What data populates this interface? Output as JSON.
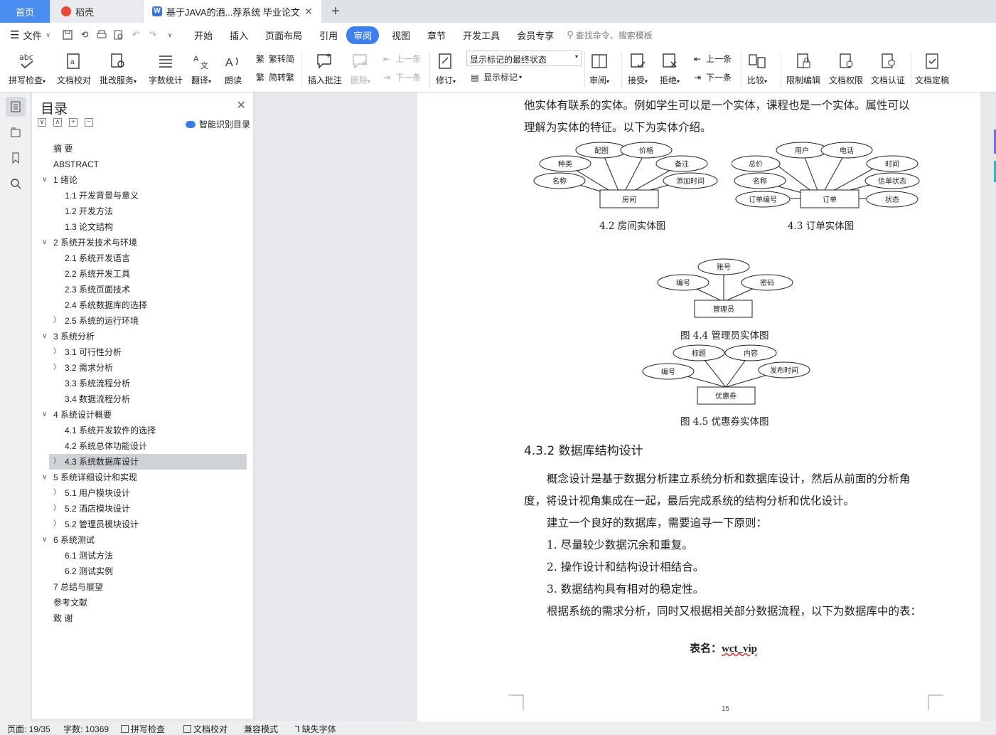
{
  "tabs": {
    "home": "首页",
    "daoke": "稻壳",
    "doc": "基于JAVA的酒...荐系统 毕业论文"
  },
  "menu": {
    "file": "文件",
    "items": [
      "开始",
      "插入",
      "页面布局",
      "引用",
      "审阅",
      "视图",
      "章节",
      "开发工具",
      "会员专享"
    ],
    "active": "审阅",
    "search_placeholder": "查找命令、搜索模板"
  },
  "ribbon": {
    "spell_check": "拼写检查",
    "doc_proof": "文档校对",
    "review_service": "批改服务",
    "word_count": "字数统计",
    "translate": "翻译",
    "read_aloud": "朗读",
    "to_traditional": "繁转简",
    "to_simplified": "简转繁",
    "insert_comment": "插入批注",
    "delete": "删除",
    "prev_item": "上一条",
    "next_item": "下一条",
    "revise": "修订",
    "markup_select": "显示标记的最终状态",
    "show_markup": "显示标记",
    "review": "审阅",
    "accept": "接受",
    "reject": "拒绝",
    "prev": "上一条",
    "next": "下一条",
    "compare": "比较",
    "restrict_edit": "限制编辑",
    "doc_permission": "文档权限",
    "doc_certify": "文档认证",
    "doc_finalize": "文档定稿"
  },
  "toc": {
    "title": "目录",
    "smart_label": "智能识别目录",
    "items": [
      {
        "label": "摘    要",
        "level": 0,
        "chevron": ""
      },
      {
        "label": "ABSTRACT",
        "level": 0,
        "chevron": ""
      },
      {
        "label": "1 绪论",
        "level": 0,
        "chevron": "down"
      },
      {
        "label": "1.1 开发背景与意义",
        "level": 1,
        "chevron": ""
      },
      {
        "label": "1.2 开发方法",
        "level": 1,
        "chevron": ""
      },
      {
        "label": "1.3 论文结构",
        "level": 1,
        "chevron": ""
      },
      {
        "label": "2 系统开发技术与环境",
        "level": 0,
        "chevron": "down"
      },
      {
        "label": "2.1  系统开发语言",
        "level": 1,
        "chevron": ""
      },
      {
        "label": "2.2  系统开发工具",
        "level": 1,
        "chevron": ""
      },
      {
        "label": "2.3  系统页面技术",
        "level": 1,
        "chevron": ""
      },
      {
        "label": "2.4  系统数据库的选择",
        "level": 1,
        "chevron": ""
      },
      {
        "label": "2.5  系统的运行环境",
        "level": 1,
        "chevron": "right"
      },
      {
        "label": "3  系统分析",
        "level": 0,
        "chevron": "down"
      },
      {
        "label": "3.1 可行性分析",
        "level": 1,
        "chevron": "right"
      },
      {
        "label": "3.2 需求分析",
        "level": 1,
        "chevron": "right"
      },
      {
        "label": "3.3 系统流程分析",
        "level": 1,
        "chevron": ""
      },
      {
        "label": "3.4 数据流程分析",
        "level": 1,
        "chevron": ""
      },
      {
        "label": "4  系统设计概要",
        "level": 0,
        "chevron": "down"
      },
      {
        "label": "4.1  系统开发软件的选择",
        "level": 1,
        "chevron": ""
      },
      {
        "label": "4.2  系统总体功能设计",
        "level": 1,
        "chevron": ""
      },
      {
        "label": "4.3  系统数据库设计",
        "level": 1,
        "chevron": "right",
        "selected": true
      },
      {
        "label": "5  系统详细设计和实现",
        "level": 0,
        "chevron": "down"
      },
      {
        "label": "5.1  用户模块设计",
        "level": 1,
        "chevron": "right"
      },
      {
        "label": "5.2  酒店模块设计",
        "level": 1,
        "chevron": "right"
      },
      {
        "label": "5.2  管理员模块设计",
        "level": 1,
        "chevron": "right"
      },
      {
        "label": "6  系统测试",
        "level": 0,
        "chevron": "down"
      },
      {
        "label": "6.1  测试方法",
        "level": 1,
        "chevron": ""
      },
      {
        "label": "6.2  测试实例",
        "level": 1,
        "chevron": ""
      },
      {
        "label": "7  总结与展望",
        "level": 0,
        "chevron": ""
      },
      {
        "label": "参考文献",
        "level": 0,
        "chevron": ""
      },
      {
        "label": "致    谢",
        "level": 0,
        "chevron": ""
      }
    ]
  },
  "document": {
    "line1": "他实体有联系的实体。例如学生可以是一个实体，课程也是一个实体。属性可以",
    "line2": "理解为实体的特征。以下为实体介绍。",
    "er_room": {
      "entity": "房间",
      "attributes": [
        "配图",
        "价格",
        "种类",
        "备注",
        "名称",
        "添加时间"
      ],
      "caption": "4.2 房间实体图"
    },
    "er_order": {
      "entity": "订单",
      "attributes": [
        "用户",
        "电话",
        "总价",
        "时间",
        "名称",
        "信单状态",
        "订单编号",
        "状态"
      ],
      "caption": "4.3 订单实体图"
    },
    "er_admin": {
      "entity": "管理员",
      "attributes": [
        "账号",
        "编号",
        "密码"
      ],
      "caption": "图 4.4  管理员实体图"
    },
    "er_coupon": {
      "entity": "优惠券",
      "attributes": [
        "标题",
        "内容",
        "编号",
        "发布时间"
      ],
      "caption": "图 4.5  优惠券实体图"
    },
    "heading": "4.3.2  数据库结构设计",
    "para1a": "概念设计是基于数据分析建立系统分析和数据库设计，然后从前面的分析角",
    "para1b": "度，将设计视角集成在一起，最后完成系统的结构分析和优化设计。",
    "para2": "建立一个良好的数据库，需要追寻一下原则：",
    "list1": "1.  尽量较少数据沉余和重复。",
    "list2": "2.  操作设计和结构设计相结合。",
    "list3": "3.  数据结构具有相对的稳定性。",
    "para3": "根据系统的需求分析，同时又根据相关部分数据流程，以下为数据库中的表：",
    "table_label": "表名：",
    "table_name": "wct_vip",
    "page_number": "15"
  },
  "status": {
    "page": "页面: 19/35",
    "words": "字数: 10369",
    "spell": "拼写检查",
    "proof": "文档校对",
    "compat": "兼容模式",
    "missing_font": "缺失字体"
  }
}
